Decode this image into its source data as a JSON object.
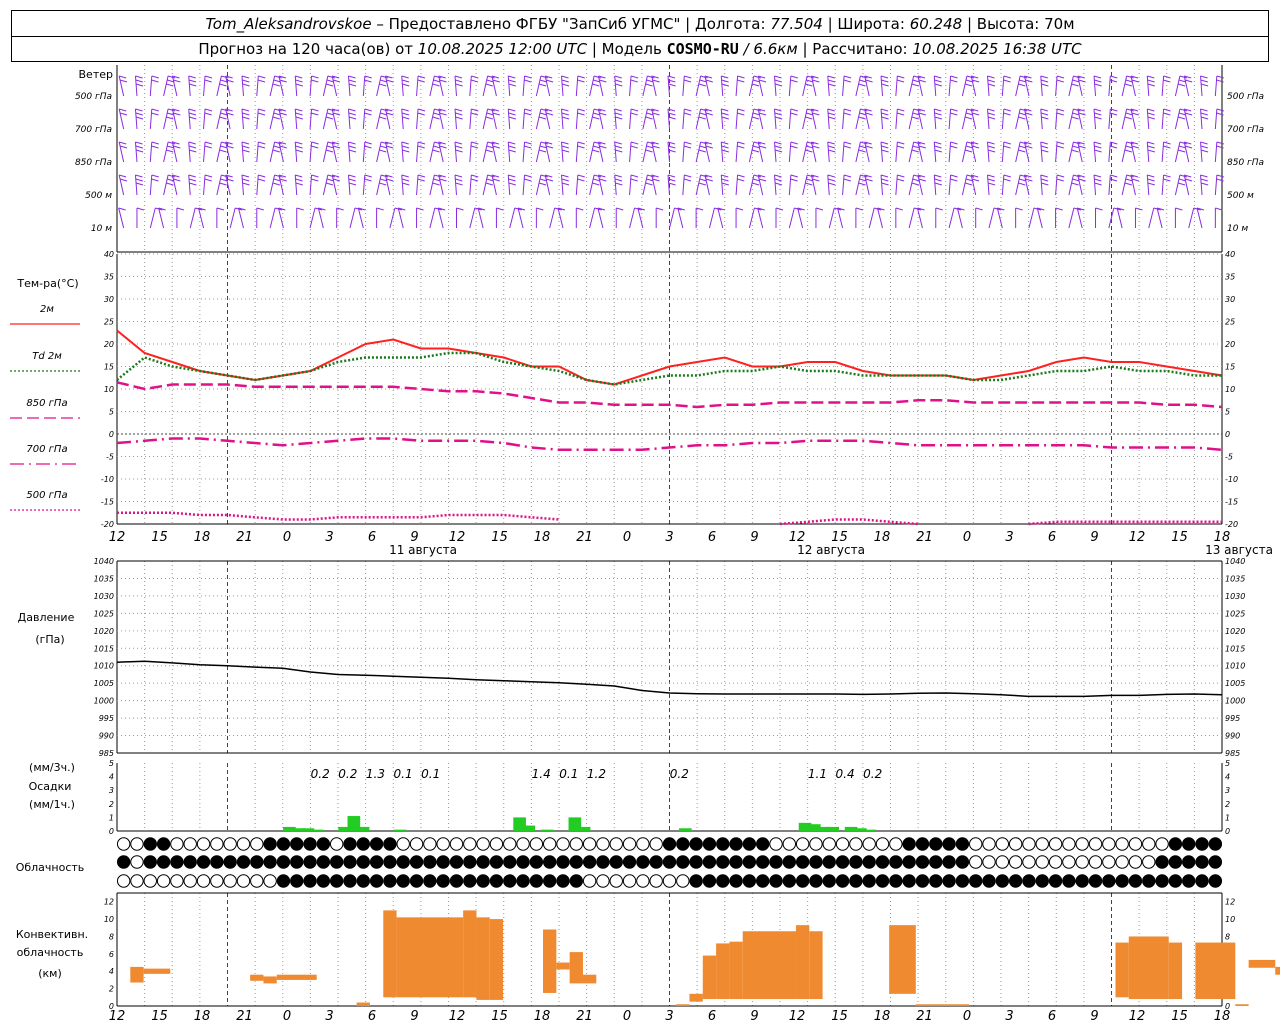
{
  "header": {
    "station": "Tom_Aleksandrovskoe",
    "provider": "– Предоставлено ФГБУ \"ЗапСиб УГМС\" |",
    "lon_label": "Долгота:",
    "lon": "77.504",
    "lat_label": "| Широта:",
    "lat": "60.248",
    "alt_label": "| Высота:",
    "alt": "70м",
    "forecast_label": "Прогноз на 120 часа(ов) от",
    "forecast_from": "10.08.2025 12:00 UTC",
    "model_label": "| Модель",
    "model": "COSMO-RU",
    "model_res": "/ 6.6км",
    "calc_label": "| Рассчитано:",
    "calc_time": "10.08.2025 16:38 UTC"
  },
  "colors": {
    "wind": "#8a2be2",
    "t2m": "#ff2020",
    "td2m": "#1a7a1a",
    "t850": "#e0108a",
    "t700": "#e0108a",
    "t500": "#e0108a",
    "pressure": "#000000",
    "precip": "#22cc22",
    "convective": "#f08a30"
  },
  "chart_data": [
    {
      "type": "wind-barbs",
      "title": "Ветер",
      "levels": [
        "500 гПа",
        "700 гПа",
        "850 гПа",
        "500 м",
        "10  м"
      ]
    },
    {
      "type": "line",
      "title": "Тем-ра(°C)",
      "ylim": [
        -20,
        40
      ],
      "yticks": [
        40,
        35,
        30,
        25,
        20,
        15,
        10,
        5,
        0,
        -5,
        -10,
        -15,
        -20
      ],
      "x_hours": [
        0,
        3,
        6,
        9,
        12,
        15,
        18,
        21,
        24,
        27,
        30,
        33,
        36,
        39,
        42,
        45,
        48,
        51,
        54,
        57,
        60,
        63,
        66,
        69,
        72,
        75,
        78,
        81,
        84,
        87,
        90,
        93,
        96,
        99,
        102,
        105,
        108,
        111,
        114,
        117,
        120
      ],
      "series": [
        {
          "name": "2м",
          "style": "solid",
          "values": [
            23,
            18,
            16,
            14,
            13,
            12,
            13,
            14,
            17,
            20,
            21,
            19,
            19,
            18,
            17,
            15,
            15,
            12,
            11,
            13,
            15,
            16,
            17,
            15,
            15,
            16,
            16,
            14,
            13,
            13,
            13,
            12,
            13,
            14,
            16,
            17,
            16,
            16,
            15,
            14,
            13
          ]
        },
        {
          "name": "Td  2м",
          "style": "dotted",
          "values": [
            12,
            17,
            15,
            14,
            13,
            12,
            13,
            14,
            16,
            17,
            17,
            17,
            18,
            18,
            16,
            15,
            14,
            12,
            11,
            12,
            13,
            13,
            14,
            14,
            15,
            14,
            14,
            13,
            13,
            13,
            13,
            12,
            12,
            13,
            14,
            14,
            15,
            14,
            14,
            13,
            13
          ]
        },
        {
          "name": "850 гПа",
          "style": "dashed",
          "values": [
            11.5,
            10,
            11,
            11,
            11,
            10.5,
            10.5,
            10.5,
            10.5,
            10.5,
            10.5,
            10,
            9.5,
            9.5,
            9,
            8,
            7,
            7,
            6.5,
            6.5,
            6.5,
            6,
            6.5,
            6.5,
            7,
            7,
            7,
            7,
            7,
            7.5,
            7.5,
            7,
            7,
            7,
            7,
            7,
            7,
            7,
            6.5,
            6.5,
            6
          ]
        },
        {
          "name": "700 гПа",
          "style": "dashdot",
          "values": [
            -2,
            -1.5,
            -1,
            -1,
            -1.5,
            -2,
            -2.5,
            -2,
            -1.5,
            -1,
            -1,
            -1.5,
            -1.5,
            -1.5,
            -2,
            -3,
            -3.5,
            -3.5,
            -3.5,
            -3.5,
            -3,
            -2.5,
            -2.5,
            -2,
            -2,
            -1.5,
            -1.5,
            -1.5,
            -2,
            -2.5,
            -2.5,
            -2.5,
            -2.5,
            -2.5,
            -2.5,
            -2.5,
            -3,
            -3,
            -3,
            -3,
            -3.5
          ]
        },
        {
          "name": "500 гПа",
          "style": "dotted",
          "values": [
            -17.5,
            -17.5,
            -17.5,
            -18,
            -18,
            -18.5,
            -19,
            -19,
            -18.5,
            -18.5,
            -18.5,
            -18.5,
            -18,
            -18,
            -18,
            -18.5,
            -19,
            null,
            null,
            null,
            null,
            null,
            null,
            null,
            -20,
            -19.5,
            -19,
            -19,
            -19.5,
            -20,
            null,
            null,
            null,
            -20,
            -19.5,
            -19.5,
            -19.5,
            -19.5,
            -19.5,
            -19.5,
            -19.5
          ]
        }
      ]
    },
    {
      "type": "line",
      "title": "Давление",
      "unit": "(гПа)",
      "ylim": [
        985,
        1040
      ],
      "yticks": [
        1040,
        1035,
        1030,
        1025,
        1020,
        1015,
        1010,
        1005,
        1000,
        995,
        990,
        985
      ],
      "x_hours": [
        0,
        3,
        6,
        9,
        12,
        15,
        18,
        21,
        24,
        27,
        30,
        33,
        36,
        39,
        42,
        45,
        48,
        51,
        54,
        57,
        60,
        63,
        66,
        69,
        72,
        75,
        78,
        81,
        84,
        87,
        90,
        93,
        96,
        99,
        102,
        105,
        108,
        111,
        114,
        117,
        120
      ],
      "series": [
        {
          "name": "Давление",
          "values": [
            1011,
            1011.3,
            1010.8,
            1010.3,
            1010,
            1009.6,
            1009.3,
            1008.2,
            1007.5,
            1007.3,
            1007,
            1006.7,
            1006.4,
            1006,
            1005.7,
            1005.4,
            1005.1,
            1004.7,
            1004.2,
            1002.9,
            1002.2,
            1002,
            1001.9,
            1001.9,
            1001.9,
            1001.9,
            1001.9,
            1001.8,
            1001.9,
            1002.1,
            1002.2,
            1002,
            1001.7,
            1001.2,
            1001.2,
            1001.2,
            1001.5,
            1001.5,
            1001.8,
            1001.9,
            1001.7
          ]
        }
      ]
    },
    {
      "type": "bar",
      "title": "Осадки",
      "unit_top": "(мм/3ч.)",
      "unit_bottom": "(мм/1ч.)",
      "ylim": [
        0,
        5
      ],
      "yticks": [
        5,
        4,
        3,
        2,
        1,
        0
      ],
      "labels_3h": [
        {
          "hour": 21,
          "value": "0.2"
        },
        {
          "hour": 24,
          "value": "0.2"
        },
        {
          "hour": 27,
          "value": "1.3"
        },
        {
          "hour": 30,
          "value": "0.1"
        },
        {
          "hour": 33,
          "value": "0.1"
        },
        {
          "hour": 45,
          "value": "1.4"
        },
        {
          "hour": 48,
          "value": "0.1"
        },
        {
          "hour": 51,
          "value": "1.2"
        },
        {
          "hour": 60,
          "value": "0.2"
        },
        {
          "hour": 75,
          "value": "1.1"
        },
        {
          "hour": 78,
          "value": "0.4"
        },
        {
          "hour": 81,
          "value": "0.2"
        }
      ],
      "hourly": [
        {
          "hour": 19,
          "value": 0.3
        },
        {
          "hour": 20,
          "value": 0.2
        },
        {
          "hour": 21,
          "value": 0.2
        },
        {
          "hour": 22,
          "value": 0.1
        },
        {
          "hour": 25,
          "value": 0.3
        },
        {
          "hour": 26,
          "value": 1.1
        },
        {
          "hour": 27,
          "value": 0.3
        },
        {
          "hour": 31,
          "value": 0.1
        },
        {
          "hour": 44,
          "value": 1.0
        },
        {
          "hour": 45,
          "value": 0.4
        },
        {
          "hour": 47,
          "value": 0.1
        },
        {
          "hour": 50,
          "value": 1.0
        },
        {
          "hour": 51,
          "value": 0.3
        },
        {
          "hour": 62,
          "value": 0.2
        },
        {
          "hour": 75,
          "value": 0.6
        },
        {
          "hour": 76,
          "value": 0.5
        },
        {
          "hour": 77,
          "value": 0.3
        },
        {
          "hour": 78,
          "value": 0.3
        },
        {
          "hour": 80,
          "value": 0.3
        },
        {
          "hour": 81,
          "value": 0.2
        },
        {
          "hour": 82,
          "value": 0.1
        }
      ]
    },
    {
      "type": "symbols",
      "title": "Облачность",
      "rows": [
        "00110000000111110111100000000000000000000111111110000000000111110000000000000001111",
        "10111111111111111111111111111111111111111111111111111111111111110000000000000011111",
        "00000000000011111111111111111111111000000001111111111111111111111111111111111111111"
      ]
    },
    {
      "type": "bar",
      "title": "Конвективн. облачность",
      "unit": "(км)",
      "ylim": [
        0,
        13
      ],
      "yticks": [
        12,
        10,
        8,
        6,
        4,
        2,
        0
      ],
      "segments": [
        {
          "from": 1,
          "to": 2,
          "base": 2.7,
          "top": 4.5
        },
        {
          "from": 2,
          "to": 4,
          "base": 3.7,
          "top": 4.3
        },
        {
          "from": 10,
          "to": 11,
          "base": 2.9,
          "top": 3.6
        },
        {
          "from": 11,
          "to": 12,
          "base": 2.6,
          "top": 3.4
        },
        {
          "from": 12,
          "to": 15,
          "base": 3.0,
          "top": 3.6
        },
        {
          "from": 18,
          "to": 19,
          "base": 0,
          "top": 0.4
        },
        {
          "from": 20,
          "to": 21,
          "base": 1.0,
          "top": 11.0
        },
        {
          "from": 21,
          "to": 26,
          "base": 1.0,
          "top": 10.2
        },
        {
          "from": 26,
          "to": 27,
          "base": 1.0,
          "top": 11.0
        },
        {
          "from": 27,
          "to": 28,
          "base": 0.7,
          "top": 10.2
        },
        {
          "from": 28,
          "to": 29,
          "base": 0.7,
          "top": 10.0
        },
        {
          "from": 32,
          "to": 33,
          "base": 1.5,
          "top": 8.8
        },
        {
          "from": 33,
          "to": 34,
          "base": 4.2,
          "top": 5.0
        },
        {
          "from": 34,
          "to": 35,
          "base": 2.6,
          "top": 6.2
        },
        {
          "from": 35,
          "to": 36,
          "base": 2.6,
          "top": 3.6
        },
        {
          "from": 42,
          "to": 43,
          "base": 0,
          "top": 0.2
        },
        {
          "from": 43,
          "to": 44,
          "base": 0.5,
          "top": 1.4
        },
        {
          "from": 44,
          "to": 45,
          "base": 0.8,
          "top": 5.8
        },
        {
          "from": 45,
          "to": 46,
          "base": 0.8,
          "top": 7.2
        },
        {
          "from": 46,
          "to": 47,
          "base": 0.8,
          "top": 7.4
        },
        {
          "from": 47,
          "to": 51,
          "base": 0.8,
          "top": 8.6
        },
        {
          "from": 51,
          "to": 52,
          "base": 0.8,
          "top": 9.3
        },
        {
          "from": 52,
          "to": 53,
          "base": 0.8,
          "top": 8.6
        },
        {
          "from": 58,
          "to": 60,
          "base": 1.4,
          "top": 9.3
        },
        {
          "from": 60,
          "to": 64,
          "base": 0,
          "top": 0.2
        },
        {
          "from": 75,
          "to": 76,
          "base": 1.0,
          "top": 7.3
        },
        {
          "from": 76,
          "to": 79,
          "base": 0.8,
          "top": 8.0
        },
        {
          "from": 79,
          "to": 80,
          "base": 0.8,
          "top": 7.3
        },
        {
          "from": 81,
          "to": 84,
          "base": 0.8,
          "top": 7.3
        },
        {
          "from": 84,
          "to": 85,
          "base": 0,
          "top": 0.2
        },
        {
          "from": 85,
          "to": 87,
          "base": 4.4,
          "top": 5.3
        },
        {
          "from": 87,
          "to": 88,
          "base": 3.6,
          "top": 4.5
        }
      ]
    }
  ],
  "x_axis": {
    "hour_labels": [
      "12",
      "15",
      "18",
      "21",
      "0",
      "3",
      "6",
      "9",
      "12",
      "15",
      "18",
      "21",
      "0",
      "3",
      "6",
      "9",
      "12",
      "15",
      "18",
      "21",
      "0",
      "3",
      "6",
      "9",
      "12",
      "15",
      "18"
    ],
    "dates": [
      {
        "hour": 36,
        "label": "11 августа"
      },
      {
        "hour": 84,
        "label": "12 августа"
      },
      {
        "hour": 132,
        "label": "13 августа"
      }
    ]
  }
}
